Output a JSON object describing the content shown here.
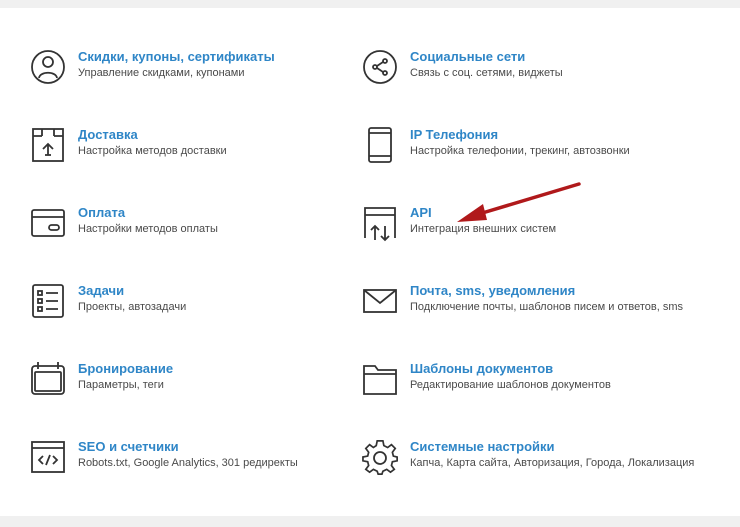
{
  "left_column": [
    {
      "id": "discounts",
      "icon": "user-circle-icon",
      "title": "Скидки, купоны, сертификаты",
      "desc": "Управление скидками, купонами"
    },
    {
      "id": "delivery",
      "icon": "box-upload-icon",
      "title": "Доставка",
      "desc": "Настройка методов доставки"
    },
    {
      "id": "payment",
      "icon": "credit-card-icon",
      "title": "Оплата",
      "desc": "Настройки методов оплаты"
    },
    {
      "id": "tasks",
      "icon": "checklist-icon",
      "title": "Задачи",
      "desc": "Проекты, автозадачи"
    },
    {
      "id": "booking",
      "icon": "calendar-icon",
      "title": "Бронирование",
      "desc": "Параметры, теги"
    },
    {
      "id": "seo",
      "icon": "code-window-icon",
      "title": "SEO и счетчики",
      "desc": "Robots.txt, Google Analytics, 301 редиректы"
    }
  ],
  "right_column": [
    {
      "id": "social",
      "icon": "share-icon",
      "title": "Социальные сети",
      "desc": "Связь с соц. сетями, виджеты"
    },
    {
      "id": "ip-phone",
      "icon": "phone-device-icon",
      "title": "IP Телефония",
      "desc": "Настройка телефонии, трекинг, автозвонки"
    },
    {
      "id": "api",
      "icon": "api-transfer-icon",
      "title": "API",
      "desc": "Интеграция внешних систем"
    },
    {
      "id": "mail",
      "icon": "envelope-icon",
      "title": "Почта, sms, уведомления",
      "desc": "Подключение почты, шаблонов писем и ответов, sms"
    },
    {
      "id": "templates",
      "icon": "folder-icon",
      "title": "Шаблоны документов",
      "desc": "Редактирование шаблонов документов"
    },
    {
      "id": "system",
      "icon": "gear-icon",
      "title": "Системные настройки",
      "desc": "Капча, Карта сайта, Авторизация, Города, Локализация"
    }
  ],
  "colors": {
    "title": "#2f86c7",
    "desc": "#4a4a4a",
    "icon": "#333333",
    "arrow": "#b0191b"
  }
}
